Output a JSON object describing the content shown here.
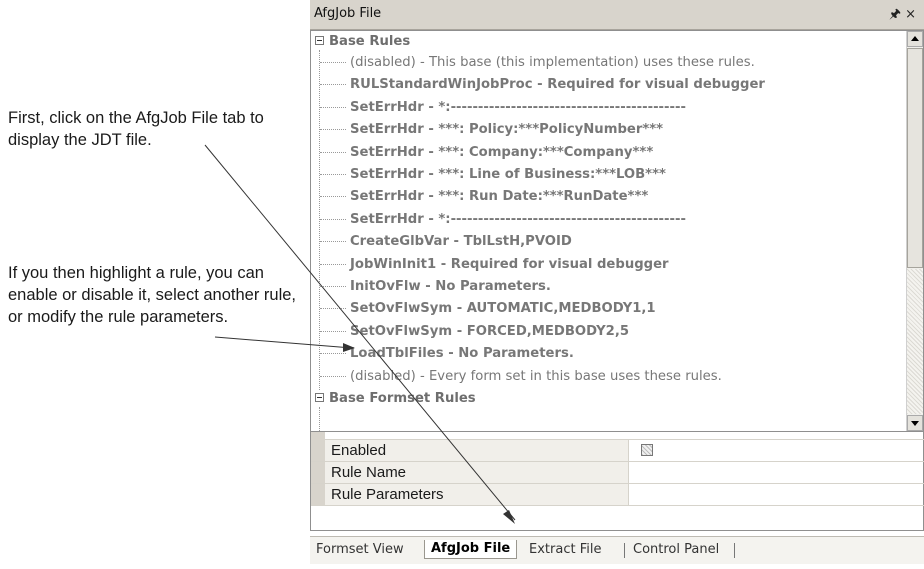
{
  "callouts": {
    "first": "First, click on the AfgJob File tab to display the JDT file.",
    "second": "If you then highlight a rule, you can enable or disable it, select another rule, or modify the rule parameters."
  },
  "panel": {
    "title": "AfgJob File",
    "pin_icon": "pin-icon",
    "close_icon": "close-icon"
  },
  "tree": {
    "group1": "Base Rules",
    "items": [
      {
        "text": "(disabled)  -  This base (this implementation) uses these rules.",
        "bold": false
      },
      {
        "text": "RULStandardWinJobProc - Required for visual debugger",
        "bold": true
      },
      {
        "text": "SetErrHdr - *:-------------------------------------------",
        "bold": true
      },
      {
        "text": "SetErrHdr - ***: Policy:***PolicyNumber***",
        "bold": true
      },
      {
        "text": "SetErrHdr - ***: Company:***Company***",
        "bold": true
      },
      {
        "text": "SetErrHdr - ***: Line of Business:***LOB***",
        "bold": true
      },
      {
        "text": "SetErrHdr - ***: Run Date:***RunDate***",
        "bold": true
      },
      {
        "text": "SetErrHdr - *:-------------------------------------------",
        "bold": true
      },
      {
        "text": "CreateGlbVar - TblLstH,PVOID",
        "bold": true
      },
      {
        "text": "JobWinInit1 - Required for visual debugger",
        "bold": true
      },
      {
        "text": "InitOvFlw - No Parameters.",
        "bold": true
      },
      {
        "text": "SetOvFlwSym - AUTOMATIC,MEDBODY1,1",
        "bold": true
      },
      {
        "text": "SetOvFlwSym - FORCED,MEDBODY2,5",
        "bold": true
      },
      {
        "text": "LoadTblFiles - No Parameters.",
        "bold": true
      },
      {
        "text": "(disabled)  -  Every form set in this base uses these rules.",
        "bold": false
      }
    ],
    "group2": "Base Formset Rules"
  },
  "properties": [
    {
      "name": "Enabled",
      "value": ""
    },
    {
      "name": "Rule Name",
      "value": ""
    },
    {
      "name": "Rule Parameters",
      "value": ""
    }
  ],
  "tabs": [
    "Formset View",
    "AfgJob File",
    "Extract File",
    "Control Panel"
  ],
  "active_tab": "AfgJob File"
}
